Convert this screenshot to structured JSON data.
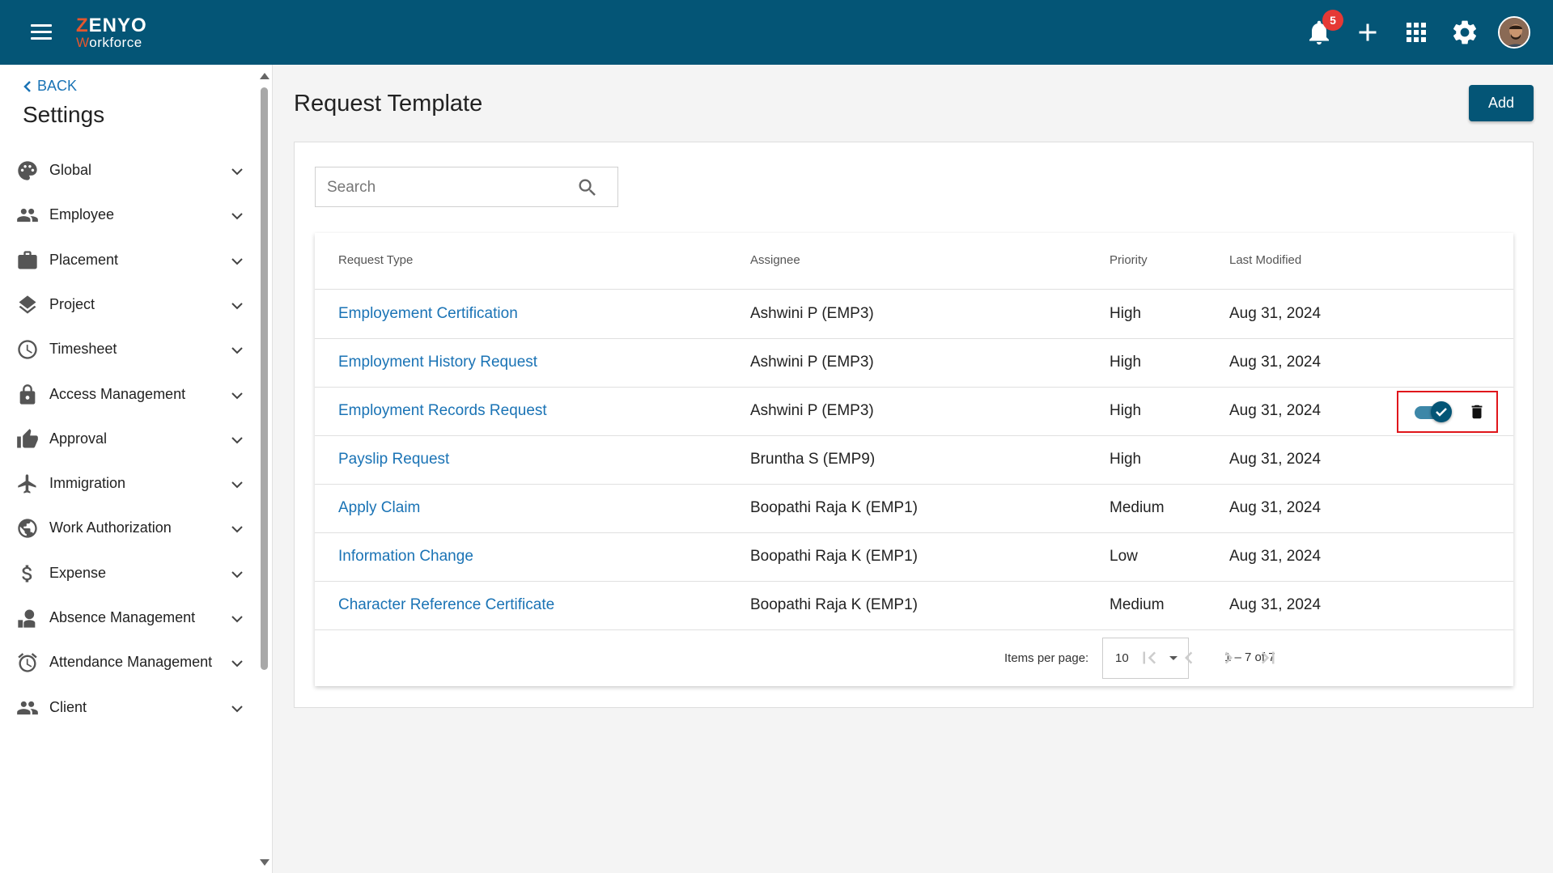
{
  "header": {
    "logo_top": "ZENYO",
    "logo_bottom": "Workforce",
    "notification_count": "5"
  },
  "sidebar": {
    "back_label": "BACK",
    "title": "Settings",
    "items": [
      {
        "label": "Global",
        "icon": "palette-icon"
      },
      {
        "label": "Employee",
        "icon": "people-icon"
      },
      {
        "label": "Placement",
        "icon": "briefcase-icon"
      },
      {
        "label": "Project",
        "icon": "layers-icon"
      },
      {
        "label": "Timesheet",
        "icon": "clock-icon"
      },
      {
        "label": "Access Management",
        "icon": "lock-icon"
      },
      {
        "label": "Approval",
        "icon": "thumbs-up-icon"
      },
      {
        "label": "Immigration",
        "icon": "airplane-icon"
      },
      {
        "label": "Work Authorization",
        "icon": "globe-icon"
      },
      {
        "label": "Expense",
        "icon": "dollar-icon"
      },
      {
        "label": "Absence Management",
        "icon": "person-away-icon"
      },
      {
        "label": "Attendance Management",
        "icon": "alarm-icon"
      },
      {
        "label": "Client",
        "icon": "people-icon"
      }
    ]
  },
  "main": {
    "title": "Request Template",
    "add_label": "Add",
    "search_placeholder": "Search",
    "columns": [
      "Request Type",
      "Assignee",
      "Priority",
      "Last Modified"
    ],
    "rows": [
      {
        "type": "Employement Certification",
        "assignee": "Ashwini P (EMP3)",
        "priority": "High",
        "modified": "Aug 31, 2024"
      },
      {
        "type": "Employment History Request",
        "assignee": "Ashwini P (EMP3)",
        "priority": "High",
        "modified": "Aug 31, 2024"
      },
      {
        "type": "Employment Records Request",
        "assignee": "Ashwini P (EMP3)",
        "priority": "High",
        "modified": "Aug 31, 2024"
      },
      {
        "type": "Payslip Request",
        "assignee": "Bruntha S (EMP9)",
        "priority": "High",
        "modified": "Aug 31, 2024"
      },
      {
        "type": "Apply Claim",
        "assignee": "Boopathi Raja K (EMP1)",
        "priority": "Medium",
        "modified": "Aug 31, 2024"
      },
      {
        "type": "Information Change",
        "assignee": "Boopathi Raja K (EMP1)",
        "priority": "Low",
        "modified": "Aug 31, 2024"
      },
      {
        "type": "Character Reference Certificate",
        "assignee": "Boopathi Raja K (EMP1)",
        "priority": "Medium",
        "modified": "Aug 31, 2024"
      }
    ],
    "hovered_row_actions": {
      "toggle_on": true
    },
    "paginator": {
      "items_per_page_label": "Items per page:",
      "items_per_page": "10",
      "range": "1 – 7 of 7"
    }
  },
  "colors": {
    "primary": "#045576",
    "link": "#1a73b5",
    "badge": "#e53935",
    "highlight": "#e0161b"
  }
}
